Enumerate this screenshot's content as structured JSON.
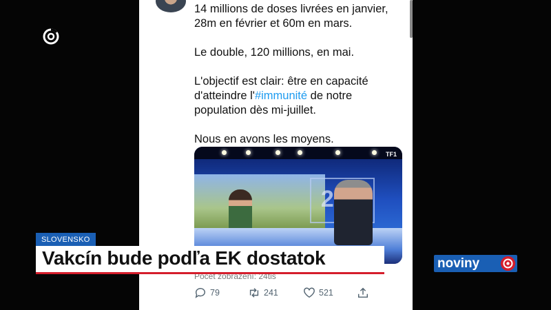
{
  "tweet": {
    "paragraphs": [
      [
        "14 millions de doses livrées en janvier,",
        "28m en février et 60m en mars."
      ],
      [
        "Le double, 120 millions, en mai."
      ],
      [
        "L'objectif est clair: être en capacité",
        "d'atteindre l'",
        "#immunité",
        " de notre",
        "population dès mi-juillet."
      ],
      [
        "Nous en avons les moyens."
      ]
    ],
    "views_text": "Počet zobrazení: 24tis",
    "replies": "79",
    "retweets": "241",
    "likes": "521"
  },
  "media": {
    "channel_mark": "TF1"
  },
  "lower_third": {
    "tag": "SLOVENSKO",
    "headline": "Vakcín bude podľa EK dostatok"
  },
  "branding": {
    "logo_text": "noviny",
    "accent_red": "#d51d2b",
    "accent_blue": "#1a5fb4"
  }
}
